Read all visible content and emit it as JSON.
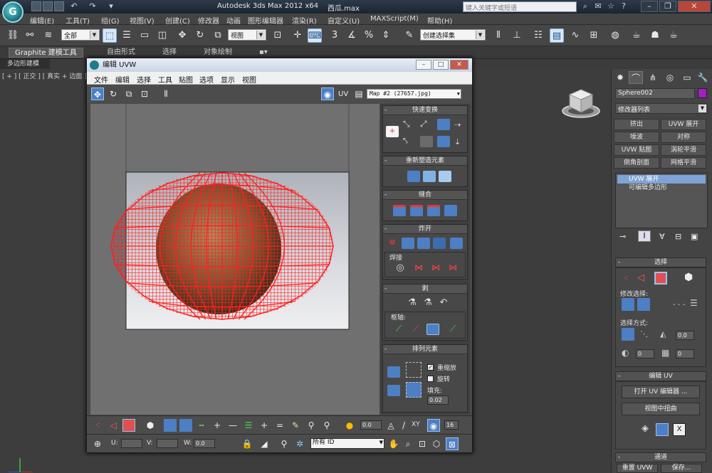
{
  "app": {
    "title": "Autodesk 3ds Max  2012 x64",
    "file": "西瓜.max",
    "search_placeholder": "键入关键字或短语"
  },
  "menu": [
    "编辑(E)",
    "工具(T)",
    "组(G)",
    "视图(V)",
    "创建(C)",
    "修改器",
    "动画",
    "图形编辑器",
    "渲染(R)",
    "自定义(U)",
    "MAXScript(M)",
    "帮助(H)"
  ],
  "toolbar": {
    "selection_filter": "全部",
    "ref_coord": "视图",
    "named_selection": "创建选择集"
  },
  "ribbon": {
    "tabs": [
      "Graphite 建模工具",
      "自由形式",
      "选择",
      "对象绘制"
    ],
    "sub": "多边形建模"
  },
  "viewport": {
    "label": "[ + ] [ 正交 ] [ 真实 + 边面 ]"
  },
  "command_panel": {
    "object_name": "Sphere002",
    "object_color": "#a020c0",
    "modifier_list": "修改器列表",
    "mod_buttons": [
      "挤出",
      "UVW 展开",
      "噪波",
      "对称",
      "UVW 贴图",
      "涡轮平滑",
      "倒角剖面",
      "网格平滑"
    ],
    "stack": [
      "UVW 展开",
      "可编辑多边形"
    ],
    "rollouts": {
      "select": {
        "title": "选择",
        "modify_sel": "修改选择:",
        "sel_method": "选择方式:",
        "spin1": "0.0",
        "spin2": "0",
        "spin3": "0"
      },
      "edit_uv": {
        "title": "编辑 UV",
        "open_editor": "打开 UV 编辑器 ...",
        "tweak": "视图中扭曲"
      },
      "channel": {
        "title": "通道",
        "reset": "重置 UVW",
        "save": "保存..."
      }
    }
  },
  "uvw_dialog": {
    "title": "编辑 UVW",
    "menu": [
      "文件",
      "编辑",
      "选择",
      "工具",
      "贴图",
      "选项",
      "显示",
      "视图"
    ],
    "uv_label": "UV",
    "map_combo": "Map #2 (27657.jpg)",
    "panel": {
      "quick_transform": "快速变换",
      "reshape": "重新塑造元素",
      "stitch": "缝合",
      "explode": "炸开",
      "weld": "焊接",
      "peel": "剥",
      "pivot": "枢轴:",
      "arrange": "排列元素",
      "rescale": "重缩放",
      "rotate": "旋转",
      "padding_label": "填充:",
      "padding_value": "0.02"
    },
    "bottom": {
      "spin_value": "0.0",
      "xy": "XY",
      "grid_value": "16",
      "u_label": "U:",
      "v_label": "V:",
      "w_label": "W:",
      "w_value": "0.0",
      "id_filter": "所有 ID"
    }
  },
  "colors": {
    "uv_mesh": "#ff2020",
    "accent_blue": "#4d7fc4",
    "selected_red": "#e05050"
  }
}
